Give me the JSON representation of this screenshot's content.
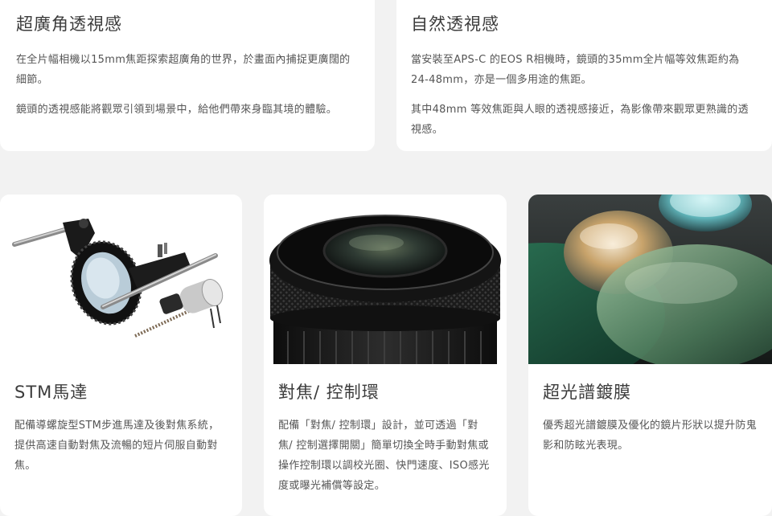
{
  "features_top": [
    {
      "title": "超廣角透視感",
      "paragraphs": [
        "在全片幅相機以15mm焦距探索超廣角的世界，於畫面內捕捉更廣闊的細節。",
        "鏡頭的透視感能將觀眾引領到場景中，給他們帶來身臨其境的體驗。"
      ]
    },
    {
      "title": "自然透視感",
      "paragraphs": [
        "當安裝至APS-C 的EOS R相機時，鏡頭的35mm全片幅等效焦距約為24-48mm，亦是一個多用途的焦距。",
        "其中48mm 等效焦距與人眼的透視感接近，為影像帶來觀眾更熟識的透視感。"
      ]
    }
  ],
  "features_bottom": [
    {
      "title": "STM馬達",
      "body": "配備導螺旋型STM步進馬達及後對焦系統，提供高速自動對焦及流暢的短片伺服自動對焦。",
      "image": "stm-motor-illustration"
    },
    {
      "title": "對焦/ 控制環",
      "body": "配備「對焦/ 控制環」設計，並可透過「對焦/ 控制選擇開關」簡單切換全時手動對焦或操作控制環以調校光圈、快門速度、ISO感光度或曝光補償等設定。",
      "image": "lens-front-photo"
    },
    {
      "title": "超光譜鍍膜",
      "body": "優秀超光譜鍍膜及優化的鏡片形狀以提升防鬼影和防眩光表現。",
      "image": "coated-glass-elements"
    }
  ],
  "colors": {
    "page_bg": "#f2f2f2",
    "card_bg": "#ffffff",
    "title_text": "#3c3c3c",
    "body_text": "#555555"
  }
}
